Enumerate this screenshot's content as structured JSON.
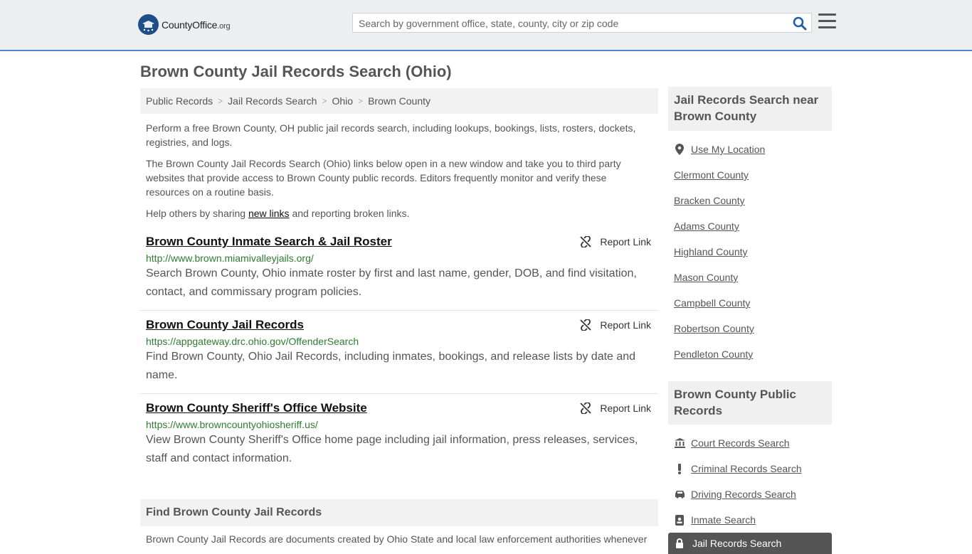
{
  "header": {
    "logo_brand": "CountyOffice",
    "logo_tld": ".org",
    "search_placeholder": "Search by government office, state, county, city or zip code"
  },
  "page_title": "Brown County Jail Records Search (Ohio)",
  "breadcrumb": [
    "Public Records",
    "Jail Records Search",
    "Ohio",
    "Brown County"
  ],
  "intro": {
    "p1": "Perform a free Brown County, OH public jail records search, including lookups, bookings, lists, rosters, dockets, registries, and logs.",
    "p2": "The Brown County Jail Records Search (Ohio) links below open in a new window and take you to third party websites that provide access to Brown County public records. Editors frequently monitor and verify these resources on a routine basis.",
    "p3_before": "Help others by sharing ",
    "p3_link": "new links",
    "p3_after": " and reporting broken links."
  },
  "report_label": "Report Link",
  "results": [
    {
      "title": "Brown County Inmate Search & Jail Roster",
      "url": "http://www.brown.miamivalleyjails.org/",
      "desc": "Search Brown County, Ohio inmate roster by first and last name, gender, DOB, and find visitation, contact, and commissary program policies."
    },
    {
      "title": "Brown County Jail Records",
      "url": "https://appgateway.drc.ohio.gov/OffenderSearch",
      "desc": "Find Brown County, Ohio Jail Records, including inmates, bookings, and release lists by date and name."
    },
    {
      "title": "Brown County Sheriff's Office Website",
      "url": "https://www.browncountyohiosheriff.us/",
      "desc": "View Brown County Sheriff's Office home page including jail information, press releases, services, staff and contact information."
    }
  ],
  "find_section": {
    "heading": "Find Brown County Jail Records",
    "text": "Brown County Jail Records are documents created by Ohio State and local law enforcement authorities whenever"
  },
  "sidebar": {
    "nearby_heading": "Jail Records Search near Brown County",
    "use_location": "Use My Location",
    "nearby": [
      "Clermont County",
      "Bracken County",
      "Adams County",
      "Highland County",
      "Mason County",
      "Campbell County",
      "Robertson County",
      "Pendleton County"
    ],
    "public_heading": "Brown County Public Records",
    "public_links": [
      {
        "label": "Court Records Search",
        "icon": "courthouse-icon"
      },
      {
        "label": "Criminal Records Search",
        "icon": "exclamation-icon"
      },
      {
        "label": "Driving Records Search",
        "icon": "car-icon"
      },
      {
        "label": "Inmate Search",
        "icon": "id-badge-icon"
      }
    ],
    "active_link": "Jail Records Search"
  },
  "colors": {
    "header_bg": "#eceef0",
    "header_border": "#4f86c6",
    "url_green": "#2e7d32",
    "logo_blue": "#1d4e89"
  }
}
